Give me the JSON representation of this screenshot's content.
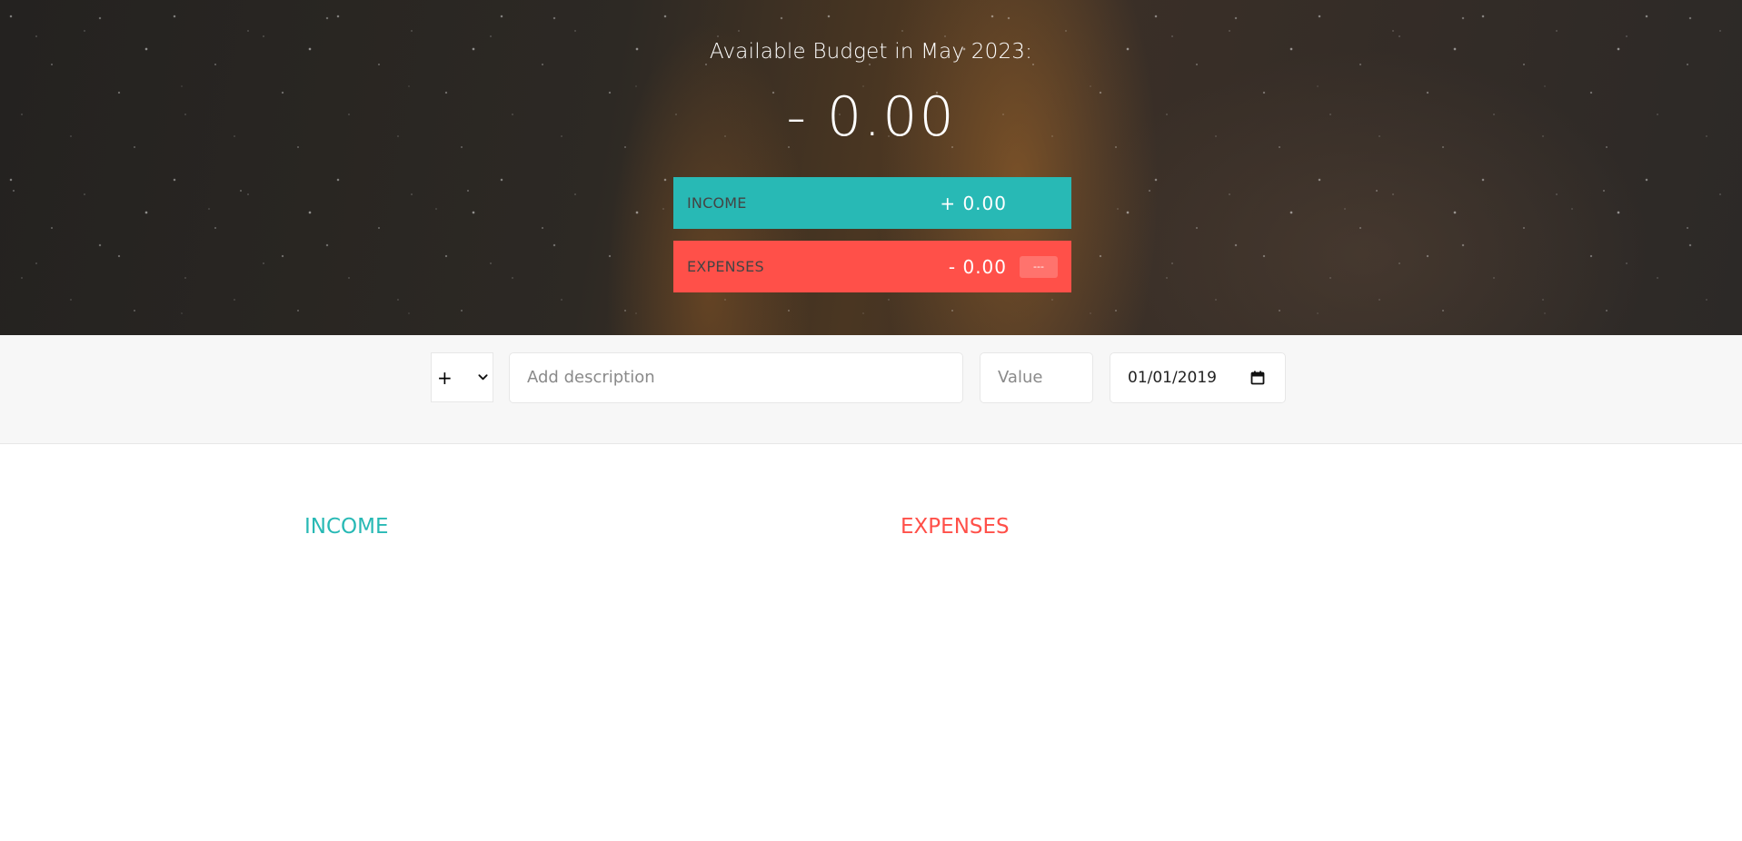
{
  "colors": {
    "income": "#28b9b5",
    "expenses": "#ff5049",
    "add_bar_background": "#f7f7f7"
  },
  "budget": {
    "title": "Available Budget in May 2023:",
    "value": "- 0.00"
  },
  "summary": {
    "income": {
      "label": "INCOME",
      "value": "+ 0.00"
    },
    "expenses": {
      "label": "EXPENSES",
      "value": "- 0.00",
      "percentage": "---"
    }
  },
  "add_form": {
    "type_selected": "+",
    "type_icon": "chevron-down-icon",
    "description_placeholder": "Add description",
    "value_placeholder": "Value",
    "date_value": "01/01/2019",
    "date_icon": "calendar-icon"
  },
  "lists": {
    "income_title": "INCOME",
    "expenses_title": "EXPENSES"
  }
}
